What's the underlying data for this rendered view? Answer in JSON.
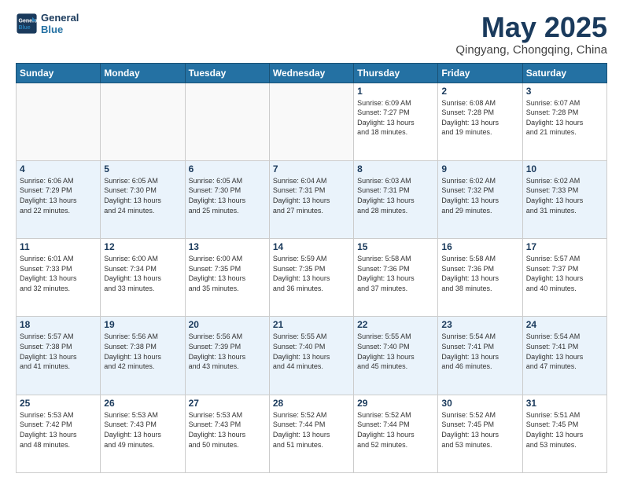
{
  "logo": {
    "line1": "General",
    "line2": "Blue"
  },
  "title": "May 2025",
  "subtitle": "Qingyang, Chongqing, China",
  "weekdays": [
    "Sunday",
    "Monday",
    "Tuesday",
    "Wednesday",
    "Thursday",
    "Friday",
    "Saturday"
  ],
  "weeks": [
    [
      {
        "day": "",
        "info": ""
      },
      {
        "day": "",
        "info": ""
      },
      {
        "day": "",
        "info": ""
      },
      {
        "day": "",
        "info": ""
      },
      {
        "day": "1",
        "info": "Sunrise: 6:09 AM\nSunset: 7:27 PM\nDaylight: 13 hours\nand 18 minutes."
      },
      {
        "day": "2",
        "info": "Sunrise: 6:08 AM\nSunset: 7:28 PM\nDaylight: 13 hours\nand 19 minutes."
      },
      {
        "day": "3",
        "info": "Sunrise: 6:07 AM\nSunset: 7:28 PM\nDaylight: 13 hours\nand 21 minutes."
      }
    ],
    [
      {
        "day": "4",
        "info": "Sunrise: 6:06 AM\nSunset: 7:29 PM\nDaylight: 13 hours\nand 22 minutes."
      },
      {
        "day": "5",
        "info": "Sunrise: 6:05 AM\nSunset: 7:30 PM\nDaylight: 13 hours\nand 24 minutes."
      },
      {
        "day": "6",
        "info": "Sunrise: 6:05 AM\nSunset: 7:30 PM\nDaylight: 13 hours\nand 25 minutes."
      },
      {
        "day": "7",
        "info": "Sunrise: 6:04 AM\nSunset: 7:31 PM\nDaylight: 13 hours\nand 27 minutes."
      },
      {
        "day": "8",
        "info": "Sunrise: 6:03 AM\nSunset: 7:31 PM\nDaylight: 13 hours\nand 28 minutes."
      },
      {
        "day": "9",
        "info": "Sunrise: 6:02 AM\nSunset: 7:32 PM\nDaylight: 13 hours\nand 29 minutes."
      },
      {
        "day": "10",
        "info": "Sunrise: 6:02 AM\nSunset: 7:33 PM\nDaylight: 13 hours\nand 31 minutes."
      }
    ],
    [
      {
        "day": "11",
        "info": "Sunrise: 6:01 AM\nSunset: 7:33 PM\nDaylight: 13 hours\nand 32 minutes."
      },
      {
        "day": "12",
        "info": "Sunrise: 6:00 AM\nSunset: 7:34 PM\nDaylight: 13 hours\nand 33 minutes."
      },
      {
        "day": "13",
        "info": "Sunrise: 6:00 AM\nSunset: 7:35 PM\nDaylight: 13 hours\nand 35 minutes."
      },
      {
        "day": "14",
        "info": "Sunrise: 5:59 AM\nSunset: 7:35 PM\nDaylight: 13 hours\nand 36 minutes."
      },
      {
        "day": "15",
        "info": "Sunrise: 5:58 AM\nSunset: 7:36 PM\nDaylight: 13 hours\nand 37 minutes."
      },
      {
        "day": "16",
        "info": "Sunrise: 5:58 AM\nSunset: 7:36 PM\nDaylight: 13 hours\nand 38 minutes."
      },
      {
        "day": "17",
        "info": "Sunrise: 5:57 AM\nSunset: 7:37 PM\nDaylight: 13 hours\nand 40 minutes."
      }
    ],
    [
      {
        "day": "18",
        "info": "Sunrise: 5:57 AM\nSunset: 7:38 PM\nDaylight: 13 hours\nand 41 minutes."
      },
      {
        "day": "19",
        "info": "Sunrise: 5:56 AM\nSunset: 7:38 PM\nDaylight: 13 hours\nand 42 minutes."
      },
      {
        "day": "20",
        "info": "Sunrise: 5:56 AM\nSunset: 7:39 PM\nDaylight: 13 hours\nand 43 minutes."
      },
      {
        "day": "21",
        "info": "Sunrise: 5:55 AM\nSunset: 7:40 PM\nDaylight: 13 hours\nand 44 minutes."
      },
      {
        "day": "22",
        "info": "Sunrise: 5:55 AM\nSunset: 7:40 PM\nDaylight: 13 hours\nand 45 minutes."
      },
      {
        "day": "23",
        "info": "Sunrise: 5:54 AM\nSunset: 7:41 PM\nDaylight: 13 hours\nand 46 minutes."
      },
      {
        "day": "24",
        "info": "Sunrise: 5:54 AM\nSunset: 7:41 PM\nDaylight: 13 hours\nand 47 minutes."
      }
    ],
    [
      {
        "day": "25",
        "info": "Sunrise: 5:53 AM\nSunset: 7:42 PM\nDaylight: 13 hours\nand 48 minutes."
      },
      {
        "day": "26",
        "info": "Sunrise: 5:53 AM\nSunset: 7:43 PM\nDaylight: 13 hours\nand 49 minutes."
      },
      {
        "day": "27",
        "info": "Sunrise: 5:53 AM\nSunset: 7:43 PM\nDaylight: 13 hours\nand 50 minutes."
      },
      {
        "day": "28",
        "info": "Sunrise: 5:52 AM\nSunset: 7:44 PM\nDaylight: 13 hours\nand 51 minutes."
      },
      {
        "day": "29",
        "info": "Sunrise: 5:52 AM\nSunset: 7:44 PM\nDaylight: 13 hours\nand 52 minutes."
      },
      {
        "day": "30",
        "info": "Sunrise: 5:52 AM\nSunset: 7:45 PM\nDaylight: 13 hours\nand 53 minutes."
      },
      {
        "day": "31",
        "info": "Sunrise: 5:51 AM\nSunset: 7:45 PM\nDaylight: 13 hours\nand 53 minutes."
      }
    ]
  ]
}
